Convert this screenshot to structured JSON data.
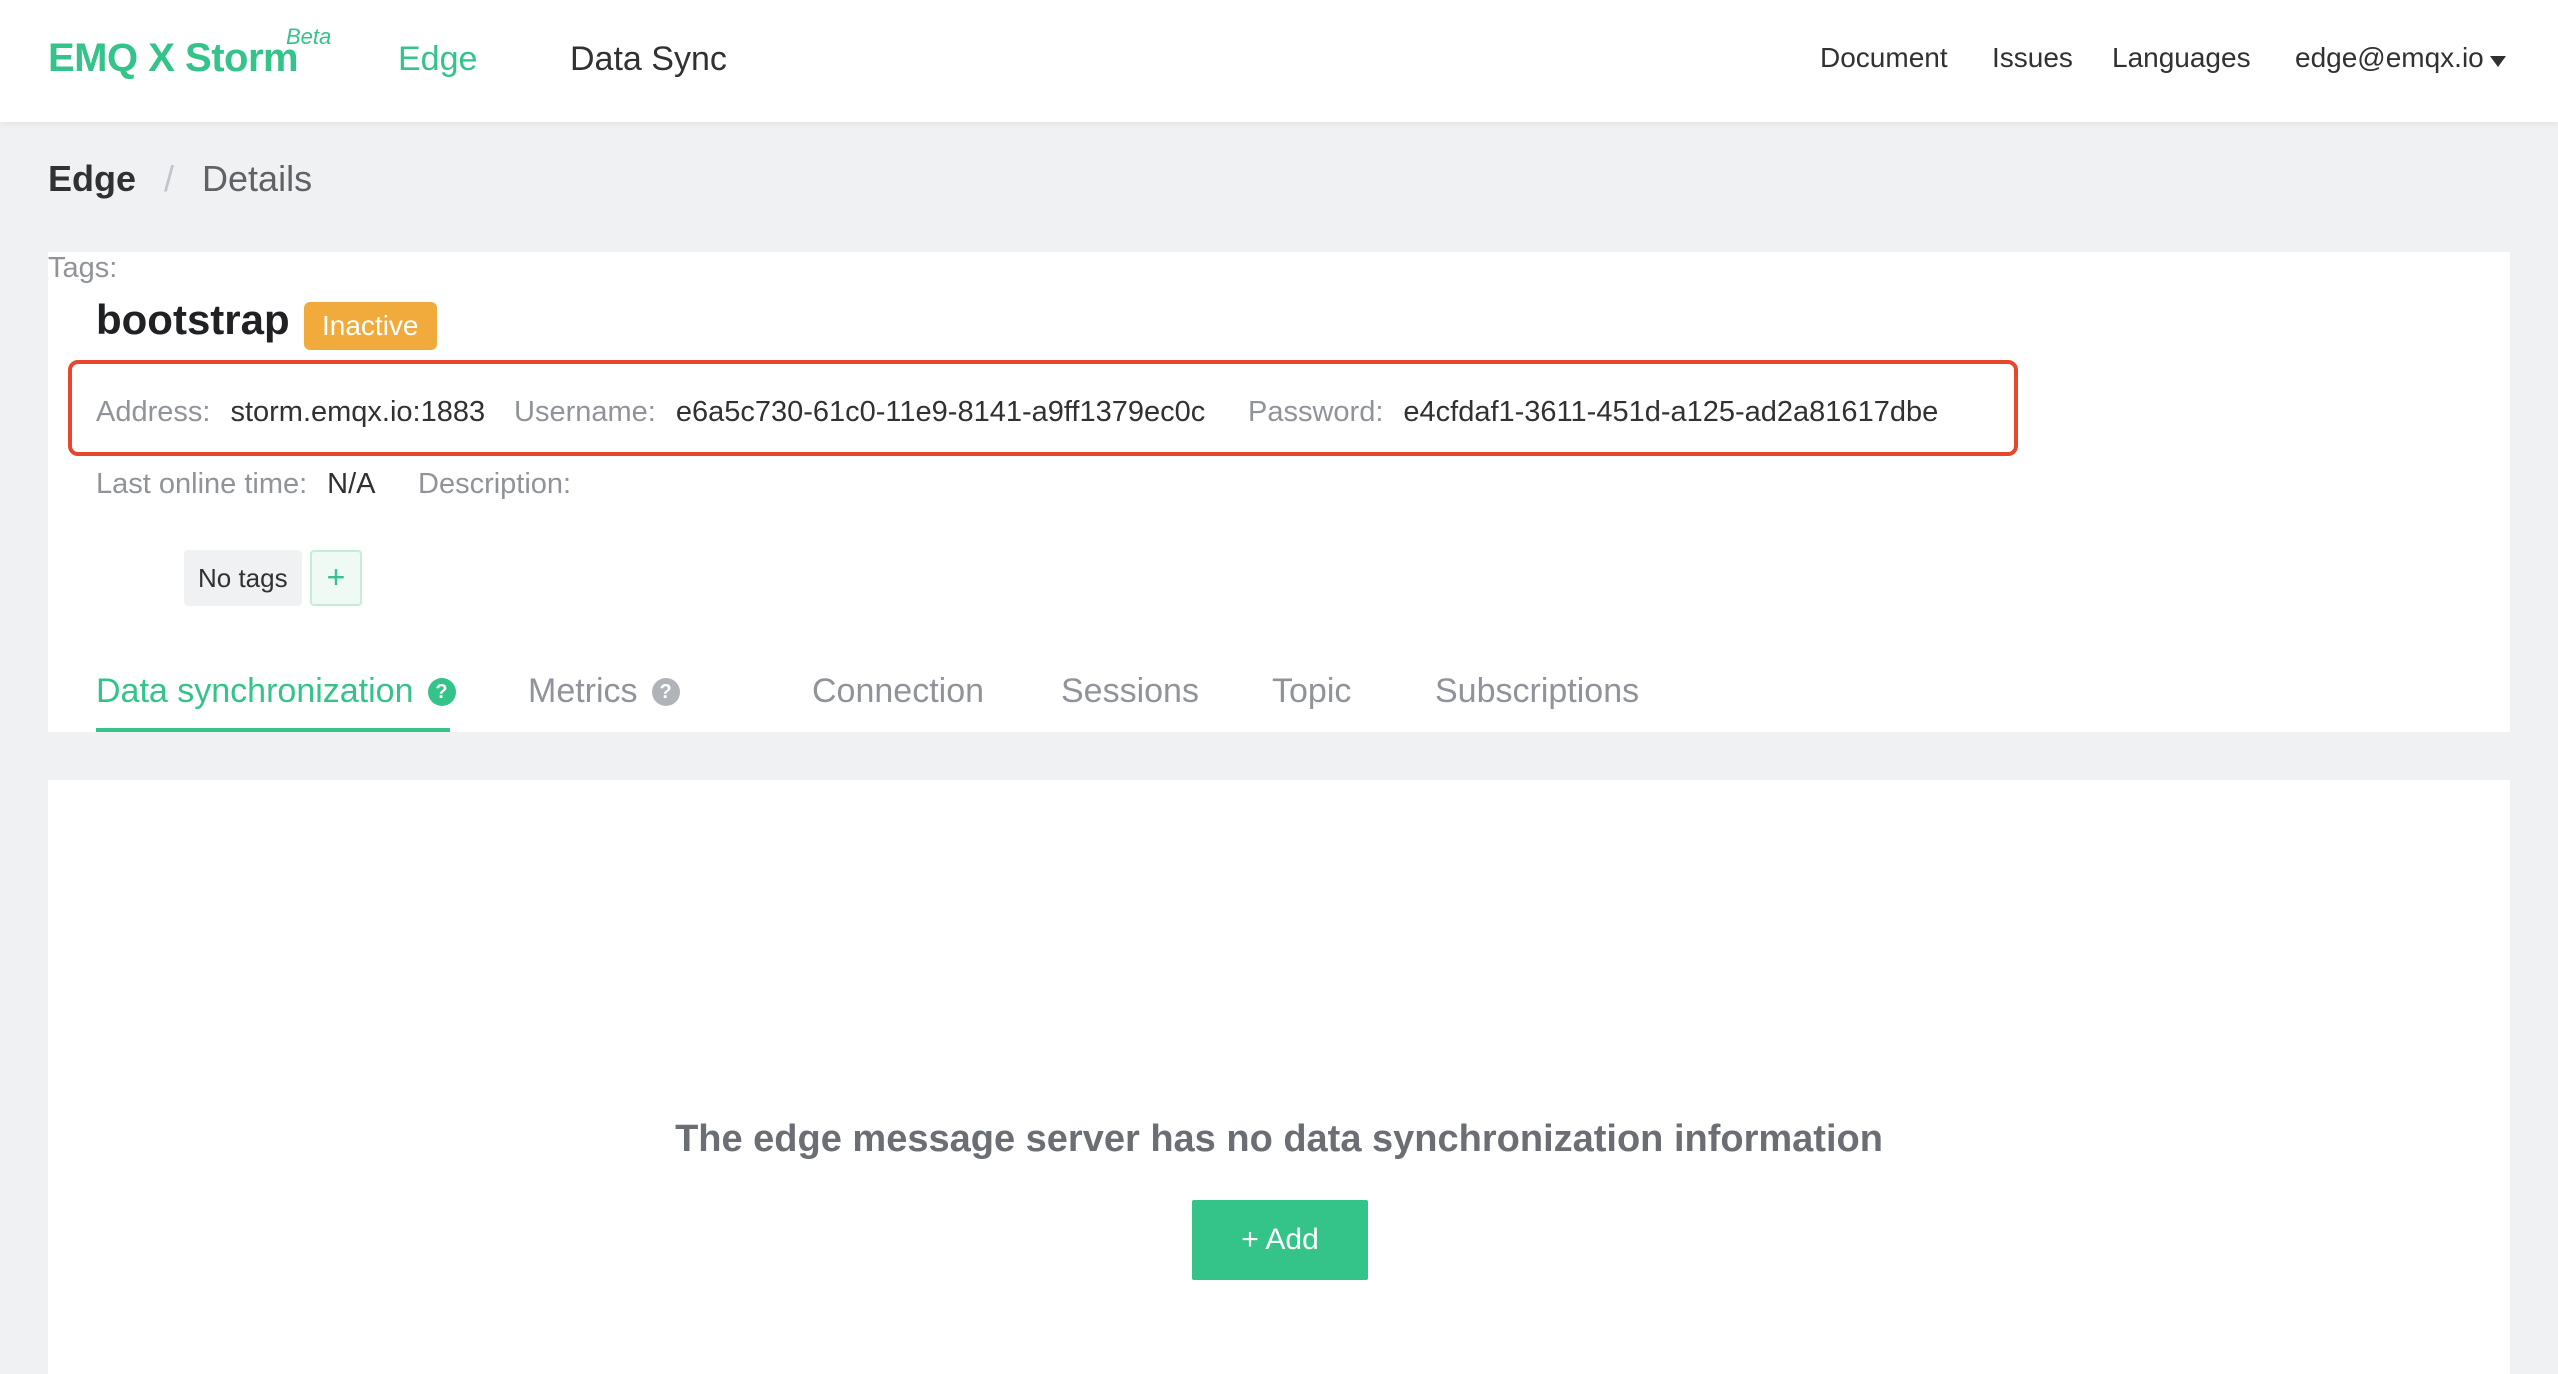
{
  "header": {
    "logo": "EMQ X Storm",
    "logo_badge": "Beta",
    "nav": [
      {
        "label": "Edge",
        "active": true
      },
      {
        "label": "Data Sync",
        "active": false
      }
    ],
    "right": {
      "document": "Document",
      "issues": "Issues",
      "languages": "Languages",
      "user": "edge@emqx.io"
    }
  },
  "breadcrumb": {
    "root": "Edge",
    "separator": "/",
    "current": "Details"
  },
  "detail": {
    "name": "bootstrap",
    "status": "Inactive",
    "address_label": "Address:",
    "address": "storm.emqx.io:1883",
    "username_label": "Username:",
    "username": "e6a5c730-61c0-11e9-8141-a9ff1379ec0c",
    "password_label": "Password:",
    "password": "e4cfdaf1-3611-451d-a125-ad2a81617dbe",
    "last_online_label": "Last online time:",
    "last_online": "N/A",
    "description_label": "Description:",
    "description": "",
    "tags_label": "Tags:",
    "tags_empty": "No tags",
    "tag_add": "+"
  },
  "tabs": [
    {
      "label": "Data synchronization",
      "active": true,
      "help": true
    },
    {
      "label": "Metrics",
      "active": false,
      "help": true
    },
    {
      "label": "Connection",
      "active": false,
      "help": false
    },
    {
      "label": "Sessions",
      "active": false,
      "help": false
    },
    {
      "label": "Topic",
      "active": false,
      "help": false
    },
    {
      "label": "Subscriptions",
      "active": false,
      "help": false
    }
  ],
  "empty_state": {
    "message": "The edge message server has no data synchronization information",
    "button": "+ Add"
  },
  "colors": {
    "brand": "#34c388",
    "status_inactive": "#f0ab3c",
    "highlight": "#e8472d"
  }
}
